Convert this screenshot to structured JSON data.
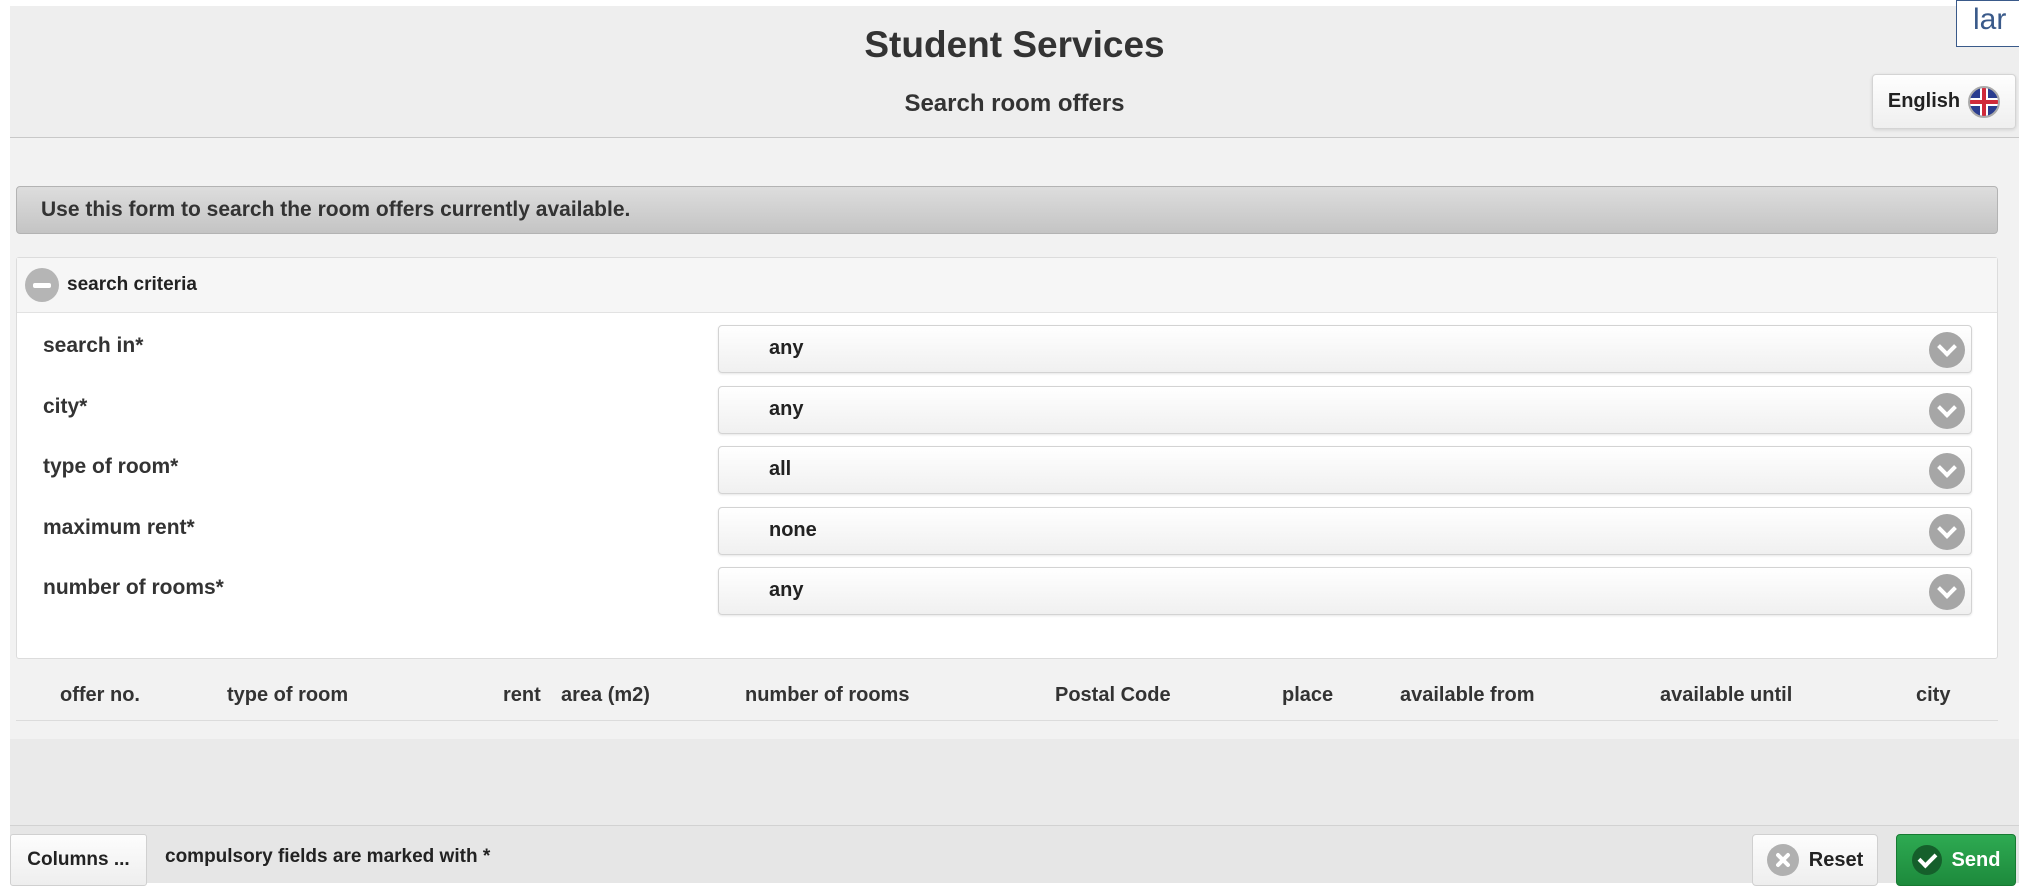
{
  "header": {
    "title": "Student Services",
    "subtitle": "Search room offers",
    "language_button": "English",
    "language_tag": "lar"
  },
  "info_bar": {
    "text": "Use this form to search the room offers currently available."
  },
  "criteria": {
    "toggle_label": "search criteria",
    "fields": [
      {
        "label": "search in*",
        "value": "any"
      },
      {
        "label": "city*",
        "value": "any"
      },
      {
        "label": "type of room*",
        "value": "all"
      },
      {
        "label": "maximum rent*",
        "value": "none"
      },
      {
        "label": "number of rooms*",
        "value": "any"
      }
    ]
  },
  "table": {
    "columns": [
      "offer no.",
      "type of room",
      "rent",
      "area (m2)",
      "number of rooms",
      "Postal Code",
      "place",
      "available from",
      "available until",
      "city"
    ]
  },
  "footer": {
    "columns_button": "Columns ...",
    "note": "compulsory fields are marked with *",
    "reset_button": "Reset",
    "send_button": "Send"
  },
  "colors": {
    "send_green": "#1d8a3c",
    "header_bg": "#eeeeee",
    "info_bar_bg": "#c4c4c4"
  },
  "icons": {
    "language": "uk-flag-icon",
    "collapse": "minus-circle-icon",
    "dropdown": "chevron-down-icon",
    "reset": "x-circle-icon",
    "send": "check-circle-icon"
  }
}
